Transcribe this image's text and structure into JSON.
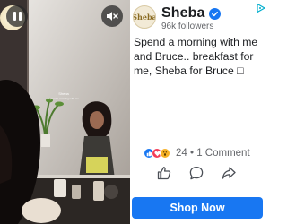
{
  "brand": {
    "name": "Sheba",
    "followers": "96k followers",
    "logo_text": "Sheba"
  },
  "video": {
    "mirror_text_top": "Sheba",
    "mirror_text_bottom": "Spend a morning with me"
  },
  "post": {
    "body": "Spend a morning with me and Bruce.. breakfast for me, Sheba for Bruce □"
  },
  "engagement": {
    "stats": "24 • 1 Comment"
  },
  "cta": {
    "label": "Shop Now"
  },
  "colors": {
    "accent": "#1877f2",
    "text": "#1c1e21",
    "muted": "#65676b"
  },
  "icons": [
    "pause-icon",
    "mute-icon",
    "verified-icon",
    "adchoices-icon",
    "like-icon",
    "comment-icon",
    "share-icon"
  ]
}
